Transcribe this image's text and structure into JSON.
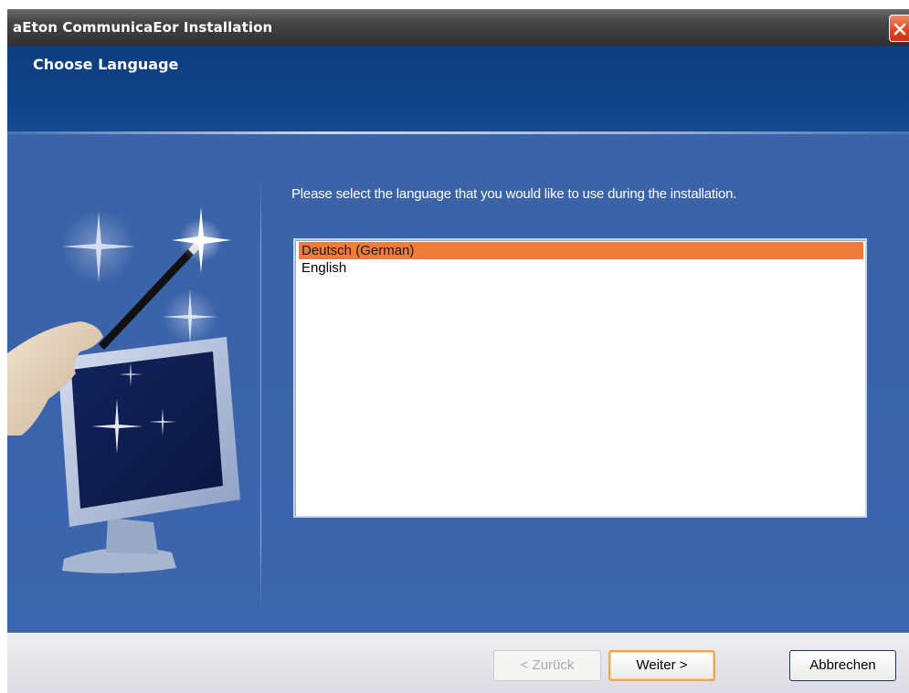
{
  "window": {
    "title": "aEton CommunicaEor Installation"
  },
  "header": {
    "title": "Choose Language"
  },
  "main": {
    "instruction": "Please select the language that you would like to use during the installation.",
    "languages": [
      {
        "label": "Deutsch (German)",
        "selected": true
      },
      {
        "label": "English",
        "selected": false
      }
    ]
  },
  "buttons": {
    "back_label": "< Zurück",
    "next_label": "Weiter >",
    "cancel_label": "Abbrechen"
  },
  "icons": {
    "close": "close-icon",
    "illustration": "wizard-monitor-illustration"
  },
  "colors": {
    "title_bar": "#3a3a3a",
    "header_band": "#0f4387",
    "body_background": "#3b63a8",
    "selection_highlight": "#f07c3c",
    "close_button": "#d9461e"
  }
}
